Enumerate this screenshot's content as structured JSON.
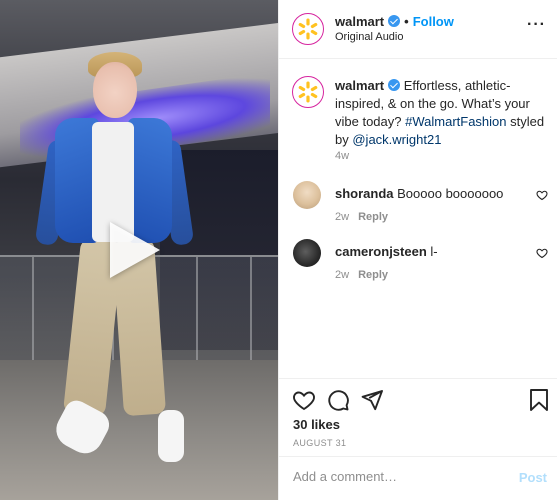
{
  "header": {
    "username": "walmart",
    "separator": "•",
    "follow_label": "Follow",
    "subtitle": "Original Audio",
    "more_label": "···"
  },
  "caption": {
    "username": "walmart",
    "text": "Effortless, athletic-inspired, & on the go. What’s your vibe today?",
    "hashtag": "#WalmartFashion",
    "styled_by": "styled by",
    "mention": "@jack.wright21",
    "time": "4w"
  },
  "comments": [
    {
      "username": "shoranda",
      "text": "Booooo booooooo",
      "time": "2w",
      "reply_label": "Reply"
    },
    {
      "username": "cameronjsteen",
      "text": "l-",
      "time": "2w",
      "reply_label": "Reply"
    }
  ],
  "engagement": {
    "likes": "30 likes",
    "date": "AUGUST 31"
  },
  "comment_box": {
    "placeholder": "Add a comment…",
    "post_label": "Post"
  },
  "colors": {
    "brand_yellow": "#ffc220",
    "link_blue": "#0095f6",
    "hashtag_blue": "#00376b",
    "verified_blue": "#3897f0",
    "muted_text": "#8e8e8e"
  },
  "icons": {
    "verified": "verified-badge-icon",
    "like": "heart-icon",
    "comment": "comment-icon",
    "share": "send-icon",
    "save": "bookmark-icon",
    "play": "play-icon",
    "logo": "walmart-spark-icon"
  }
}
